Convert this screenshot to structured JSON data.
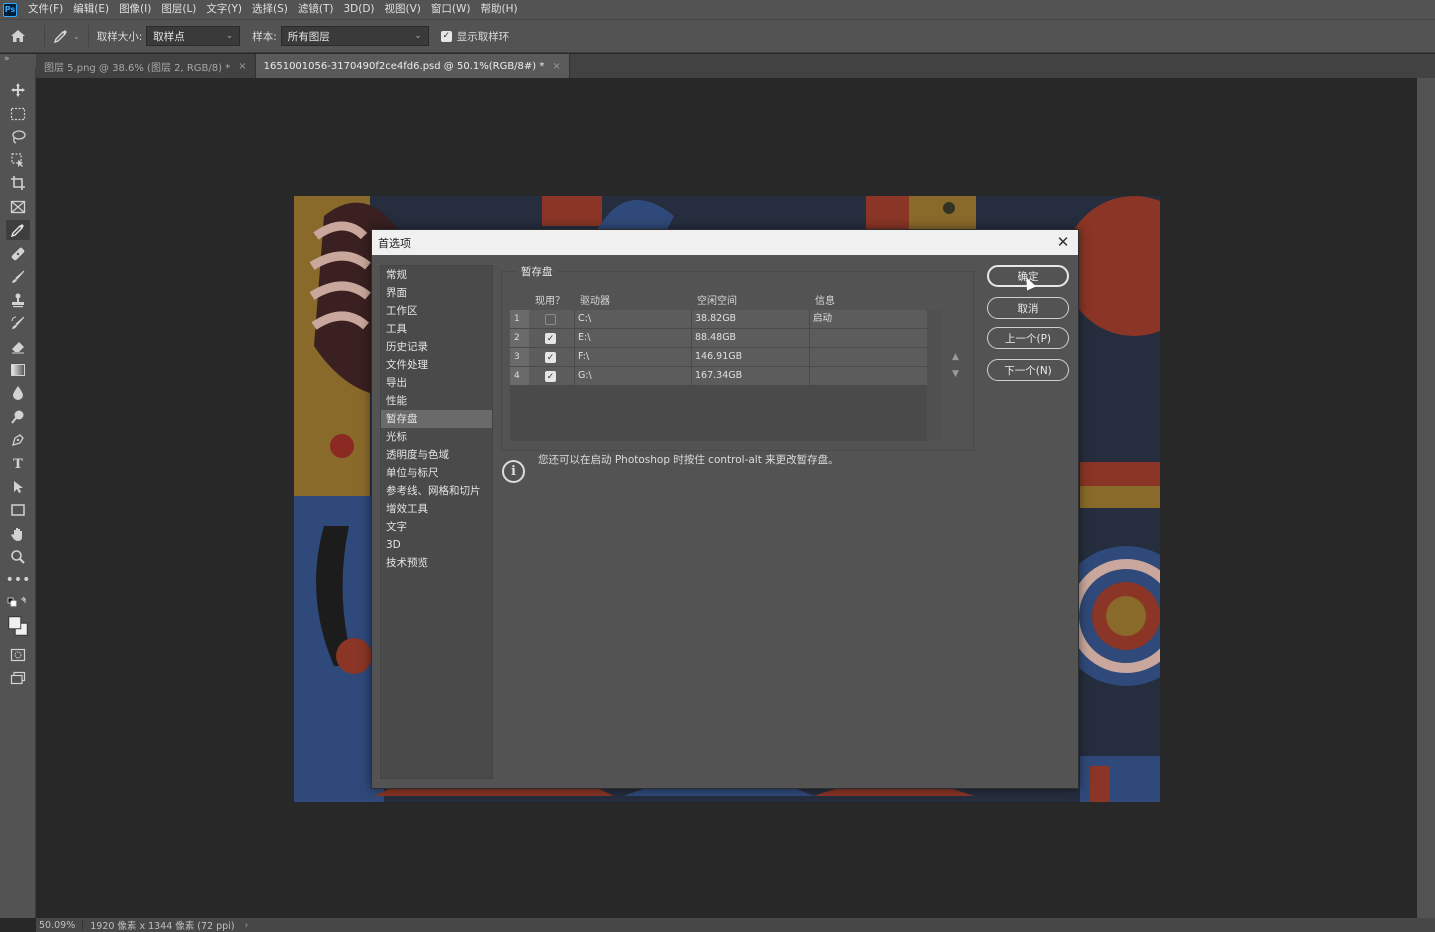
{
  "app": {
    "logo": "Ps"
  },
  "menu": [
    "文件(F)",
    "编辑(E)",
    "图像(I)",
    "图层(L)",
    "文字(Y)",
    "选择(S)",
    "滤镜(T)",
    "3D(D)",
    "视图(V)",
    "窗口(W)",
    "帮助(H)"
  ],
  "options": {
    "sample_size_label": "取样大小:",
    "sample_size_value": "取样点",
    "sample_label": "样本:",
    "sample_value": "所有图层",
    "show_ring_label": "显示取样环",
    "show_ring_checked": true
  },
  "tabs": [
    {
      "label": "图层 5.png @ 38.6% (图层 2, RGB/8) *",
      "active": false
    },
    {
      "label": "1651001056-3170490f2ce4fd6.psd @ 50.1%(RGB/8#) *",
      "active": true
    }
  ],
  "status": {
    "zoom": "50.09%",
    "doc_info": "1920 像素 x 1344 像素 (72 ppi)"
  },
  "dialog": {
    "title": "首选项",
    "categories": [
      "常规",
      "界面",
      "工作区",
      "工具",
      "历史记录",
      "文件处理",
      "导出",
      "性能",
      "暂存盘",
      "光标",
      "透明度与色域",
      "单位与标尺",
      "参考线、网格和切片",
      "增效工具",
      "文字",
      "3D",
      "技术预览"
    ],
    "selected_category": "暂存盘",
    "group_title": "暂存盘",
    "table": {
      "headers": {
        "active": "现用？",
        "drive": "驱动器",
        "free": "空闲空间",
        "info": "信息"
      },
      "rows": [
        {
          "num": "1",
          "active": false,
          "drive": "C:\\",
          "free": "38.82GB",
          "info": "启动"
        },
        {
          "num": "2",
          "active": true,
          "drive": "E:\\",
          "free": "88.48GB",
          "info": ""
        },
        {
          "num": "3",
          "active": true,
          "drive": "F:\\",
          "free": "146.91GB",
          "info": ""
        },
        {
          "num": "4",
          "active": true,
          "drive": "G:\\",
          "free": "167.34GB",
          "info": ""
        }
      ]
    },
    "info_text": "您还可以在启动 Photoshop 时按住 control-alt 来更改暂存盘。",
    "buttons": {
      "ok": "确定",
      "cancel": "取消",
      "prev": "上一个(P)",
      "next": "下一个(N)"
    }
  }
}
